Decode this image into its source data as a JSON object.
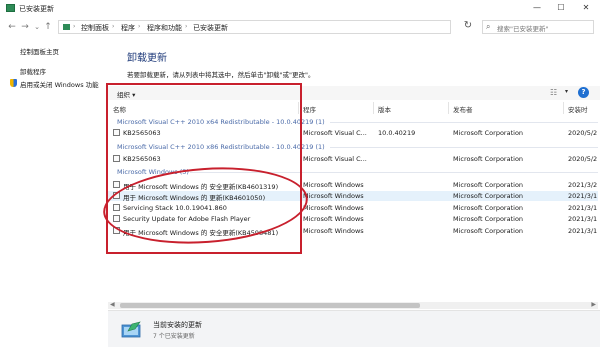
{
  "window": {
    "title": "已安装更新",
    "buttons": {
      "minimize": "—",
      "maximize": "☐",
      "close": "✕"
    }
  },
  "addressbar": {
    "back": "←",
    "forward": "→",
    "dropdown": "⌄",
    "up": "↑",
    "breadcrumbs": [
      "控制面板",
      "程序",
      "程序和功能",
      "已安装更新"
    ],
    "crumb_sep": "›",
    "dd": "⌄",
    "refresh": "↻",
    "search_placeholder": "搜索\"已安装更新\""
  },
  "sidebar": {
    "items": [
      {
        "label": "控制面板主页"
      },
      {
        "label": "卸载程序"
      },
      {
        "label": "启用或关闭 Windows 功能"
      }
    ]
  },
  "main": {
    "title": "卸载更新",
    "description": "若要卸载更新，请从列表中将其选中，然后单击\"卸载\"或\"更改\"。"
  },
  "toolbar": {
    "organize": "组织 ▾",
    "view_icon": "☷",
    "view_dd": "▾",
    "help": "?"
  },
  "columns": [
    "名称",
    "程序",
    "版本",
    "发布者",
    "安装时"
  ],
  "groups": [
    {
      "header": "Microsoft Visual C++ 2010  x64 Redistributable - 10.0.40219 (1)",
      "rows": [
        {
          "name": "KB2565063",
          "program": "Microsoft Visual C...",
          "version": "10.0.40219",
          "publisher": "Microsoft Corporation",
          "installed": "2020/5/2"
        }
      ]
    },
    {
      "header": "Microsoft Visual C++ 2010  x86 Redistributable - 10.0.40219 (1)",
      "rows": [
        {
          "name": "KB2565063",
          "program": "Microsoft Visual C...",
          "version": "",
          "publisher": "Microsoft Corporation",
          "installed": "2020/5/2"
        }
      ]
    },
    {
      "header": "Microsoft Windows (5)",
      "rows": [
        {
          "name": "用于 Microsoft Windows 的 安全更新(KB4601319)",
          "program": "Microsoft Windows",
          "version": "",
          "publisher": "Microsoft Corporation",
          "installed": "2021/3/2"
        },
        {
          "name": "用于 Microsoft Windows 的 更新(KB4601050)",
          "program": "Microsoft Windows",
          "version": "",
          "publisher": "Microsoft Corporation",
          "installed": "2021/3/1"
        },
        {
          "name": "Servicing Stack 10.0.19041.860",
          "program": "Microsoft Windows",
          "version": "",
          "publisher": "Microsoft Corporation",
          "installed": "2021/3/1"
        },
        {
          "name": "Security Update for Adobe Flash Player",
          "program": "Microsoft Windows",
          "version": "",
          "publisher": "Microsoft Corporation",
          "installed": "2021/3/1"
        },
        {
          "name": "用于 Microsoft Windows 的 安全更新(KB4598481)",
          "program": "Microsoft Windows",
          "version": "",
          "publisher": "Microsoft Corporation",
          "installed": "2021/3/1"
        }
      ]
    }
  ],
  "scrollbar": {
    "left": "◀",
    "right": "▶"
  },
  "status": {
    "title": "当前安装的更新",
    "subtitle": "7 个已安装更新"
  },
  "colors": {
    "annotation": "#c8202d",
    "title_blue": "#1e3a7a",
    "group_blue": "#4a6aa8"
  }
}
